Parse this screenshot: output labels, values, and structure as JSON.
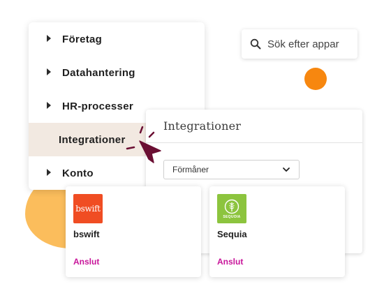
{
  "nav": {
    "items": [
      {
        "label": "Företag",
        "has_caret": true,
        "active": false
      },
      {
        "label": "Datahantering",
        "has_caret": true,
        "active": false
      },
      {
        "label": "HR-processer",
        "has_caret": true,
        "active": false
      },
      {
        "label": "Integrationer",
        "has_caret": false,
        "active": true
      },
      {
        "label": "Konto",
        "has_caret": true,
        "active": false
      }
    ]
  },
  "search": {
    "placeholder": "Sök efter appar",
    "icon": "search-icon"
  },
  "integrations_panel": {
    "title": "Integrationer",
    "filter": {
      "selected": "Förmåner",
      "icon": "chevron-down-icon"
    }
  },
  "cards": [
    {
      "name": "bswift",
      "logo_text": "bswift",
      "action": "Anslut",
      "logo_color": "#f04d23"
    },
    {
      "name": "Sequia",
      "logo_text": "SEQUOIA",
      "action": "Anslut",
      "logo_color": "#8cc43e"
    }
  ],
  "colors": {
    "accent": "#c8159a",
    "active_nav_bg": "#f2e9e1",
    "cursor": "#6b0f33",
    "blob_yellow": "#fbbd5c",
    "blob_orange": "#f7870f"
  }
}
